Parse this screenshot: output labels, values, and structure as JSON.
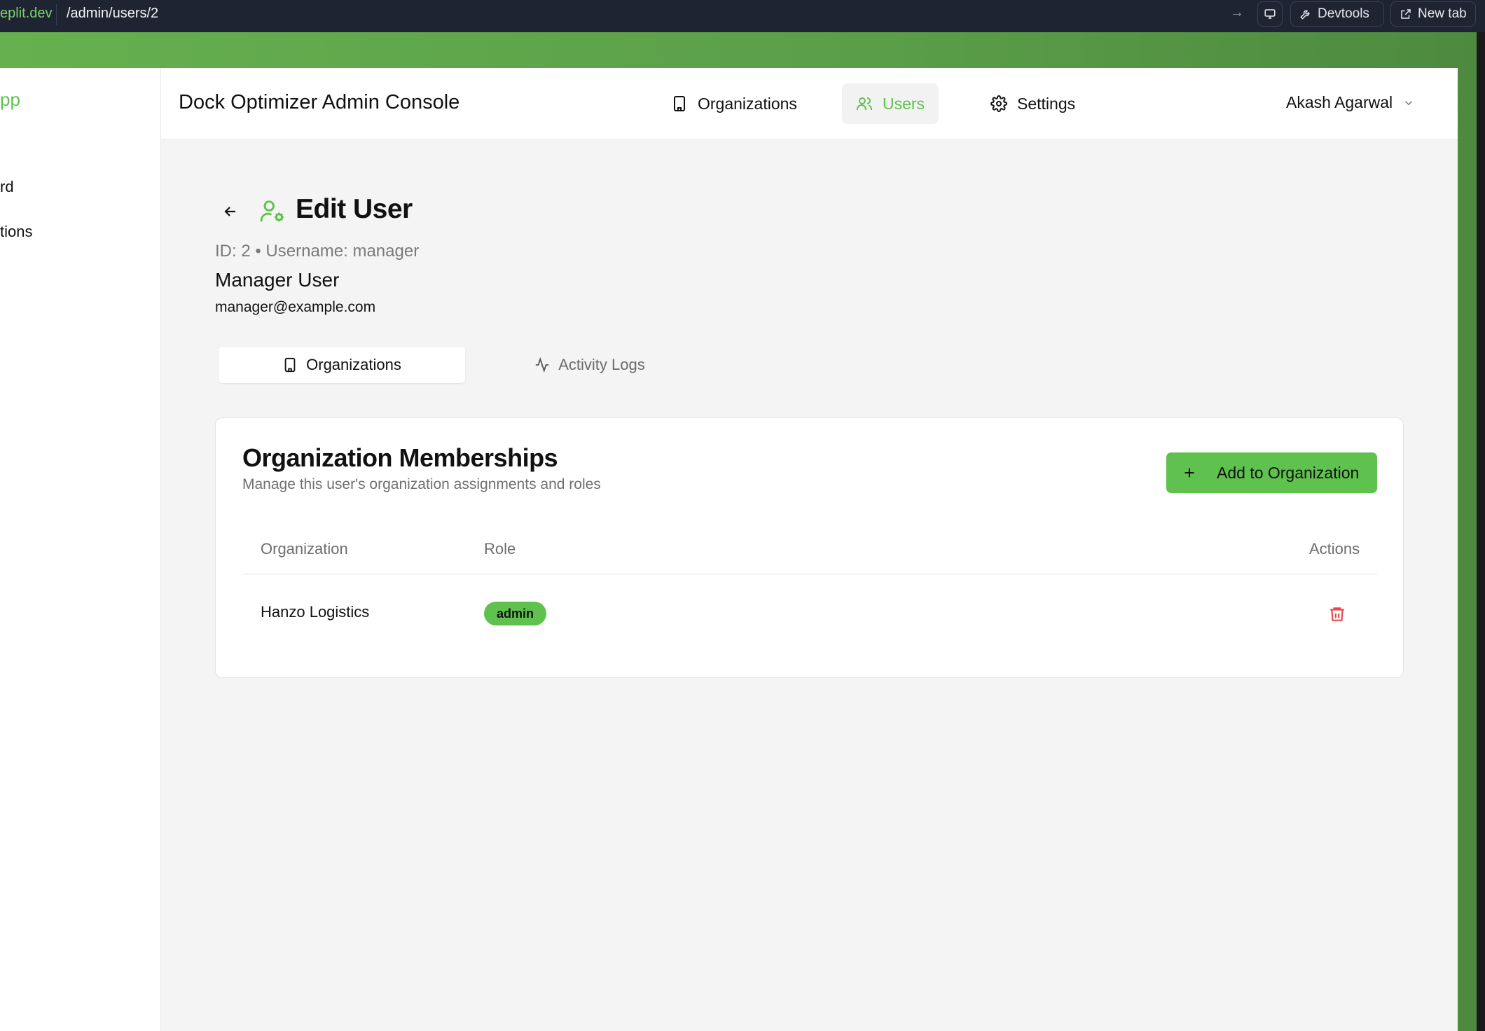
{
  "browser": {
    "host": "eplit.dev",
    "path": "/admin/users/2",
    "devtools_label": "Devtools",
    "new_tab_label": "New tab"
  },
  "sidebar": {
    "brand": "pp",
    "items": [
      {
        "label": "rd"
      },
      {
        "label": "tions"
      }
    ]
  },
  "header": {
    "title": "Dock Optimizer Admin Console",
    "nav": [
      {
        "label": "Organizations",
        "icon": "building-icon",
        "active": false
      },
      {
        "label": "Users",
        "icon": "users-icon",
        "active": true
      },
      {
        "label": "Settings",
        "icon": "gear-icon",
        "active": false
      }
    ],
    "user_name": "Akash Agarwal"
  },
  "page": {
    "title": "Edit User",
    "meta": "ID: 2 • Username: manager",
    "full_name": "Manager User",
    "email": "manager@example.com"
  },
  "tabs": [
    {
      "label": "Organizations",
      "icon": "building-icon",
      "active": true
    },
    {
      "label": "Activity Logs",
      "icon": "activity-icon",
      "active": false
    }
  ],
  "memberships": {
    "title": "Organization Memberships",
    "subtitle": "Manage this user's organization assignments and roles",
    "add_button": "Add to Organization",
    "columns": [
      "Organization",
      "Role",
      "Actions"
    ],
    "rows": [
      {
        "organization": "Hanzo Logistics",
        "role": "admin"
      }
    ]
  },
  "colors": {
    "accent": "#5fc24e",
    "danger": "#e5484d",
    "background": "#f4f4f4"
  }
}
